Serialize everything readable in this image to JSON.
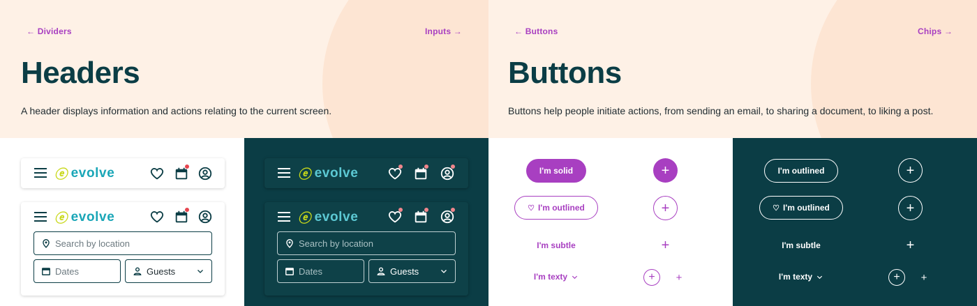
{
  "headers_page": {
    "prev_link": "← Dividers",
    "next_link": "Inputs →",
    "title": "Headers",
    "description": "A header displays information and actions relating to the current screen.",
    "logo_text": "evolve",
    "search_placeholder": "Search by location",
    "dates_placeholder": "Dates",
    "guests_label": "Guests"
  },
  "buttons_page": {
    "prev_link": "← Buttons",
    "next_link": "Chips →",
    "title": "Buttons",
    "description": "Buttons help people initiate actions, from sending an email, to sharing a document, to liking a post.",
    "solid_label": "I'm solid",
    "outlined_label": "I'm outlined",
    "subtle_label": "I'm subtle",
    "texty_label": "I'm texty"
  },
  "colors": {
    "accent": "#a83fc1",
    "brand_dark": "#0b3d45",
    "dark_bg": "#0e4148",
    "hero_bg": "#fef1e6",
    "notification": "#e6454f",
    "logo_mark": "#c8d81a",
    "logo_text": "#1aa6b7"
  },
  "icons": [
    "hamburger-icon",
    "heart-icon",
    "calendar-icon",
    "user-icon",
    "location-pin-icon",
    "plus-icon",
    "chevron-down-icon",
    "arrow-left-icon",
    "arrow-right-icon"
  ]
}
